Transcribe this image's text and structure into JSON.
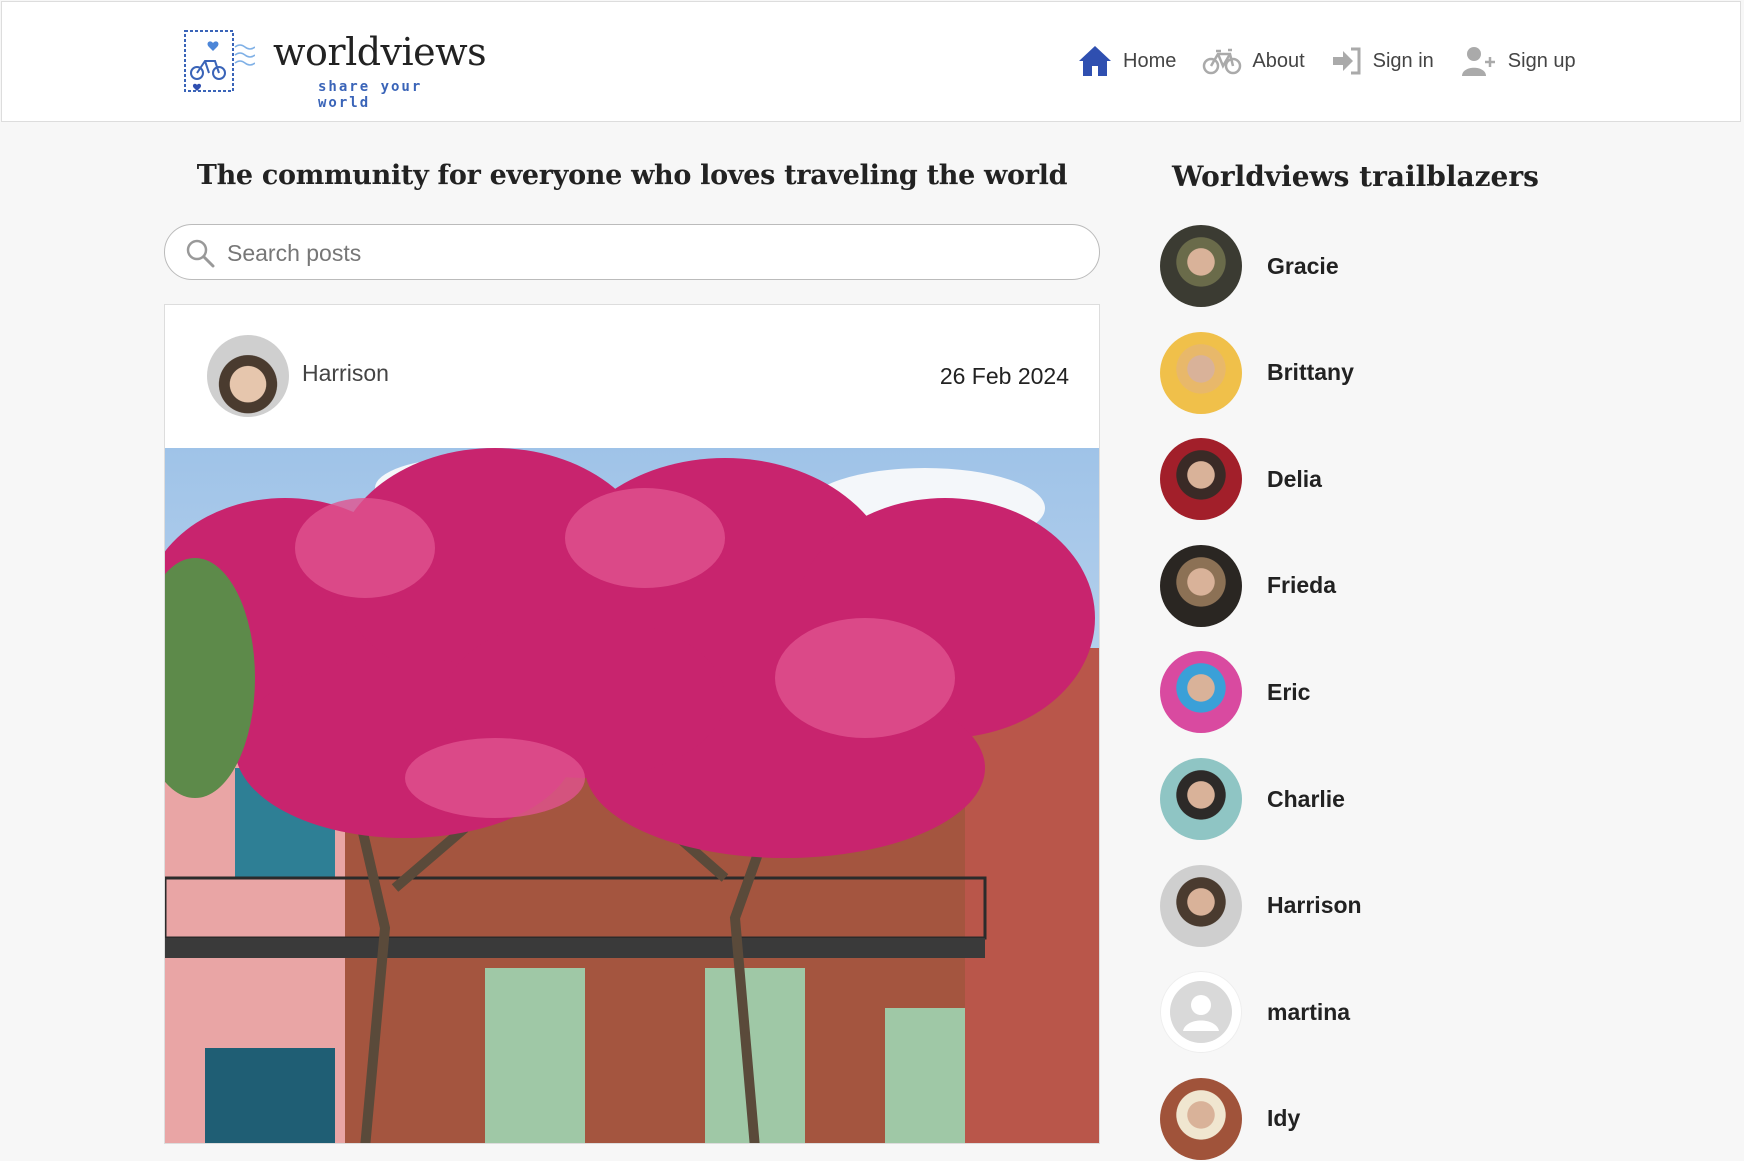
{
  "header": {
    "logo_title": "worldviews",
    "logo_tagline": "share your world",
    "nav": [
      {
        "label": "Home",
        "icon": "home-icon"
      },
      {
        "label": "About",
        "icon": "bicycle-icon"
      },
      {
        "label": "Sign in",
        "icon": "sign-in-icon"
      },
      {
        "label": "Sign up",
        "icon": "user-plus-icon"
      }
    ]
  },
  "main": {
    "tagline": "The community for everyone who loves traveling the world",
    "search_placeholder": "Search posts",
    "post": {
      "author": "Harrison",
      "date": "26 Feb 2024"
    }
  },
  "sidebar": {
    "title": "Worldviews trailblazers",
    "users": [
      {
        "name": "Gracie",
        "avatar_colors": [
          "#3b3b32",
          "#6a6b4a"
        ]
      },
      {
        "name": "Brittany",
        "avatar_colors": [
          "#f0c04a",
          "#e8b86a"
        ]
      },
      {
        "name": "Delia",
        "avatar_colors": [
          "#a21f2a",
          "#3a2a26"
        ]
      },
      {
        "name": "Frieda",
        "avatar_colors": [
          "#2a2622",
          "#8c7155"
        ]
      },
      {
        "name": "Eric",
        "avatar_colors": [
          "#d94aa0",
          "#3aa0d8"
        ]
      },
      {
        "name": "Charlie",
        "avatar_colors": [
          "#8fc5c4",
          "#2d2a28"
        ]
      },
      {
        "name": "Harrison",
        "avatar_colors": [
          "#cfcfcf",
          "#4a3b2f"
        ]
      },
      {
        "name": "martina",
        "avatar_colors": [
          "#e3e3e3",
          "#ffffff"
        ]
      },
      {
        "name": "Idy",
        "avatar_colors": [
          "#a0533a",
          "#f0e6d0"
        ]
      }
    ]
  },
  "colors": {
    "accent": "#2f4fb0",
    "header_bg": "#ffffff",
    "page_bg": "#f7f7f7"
  }
}
